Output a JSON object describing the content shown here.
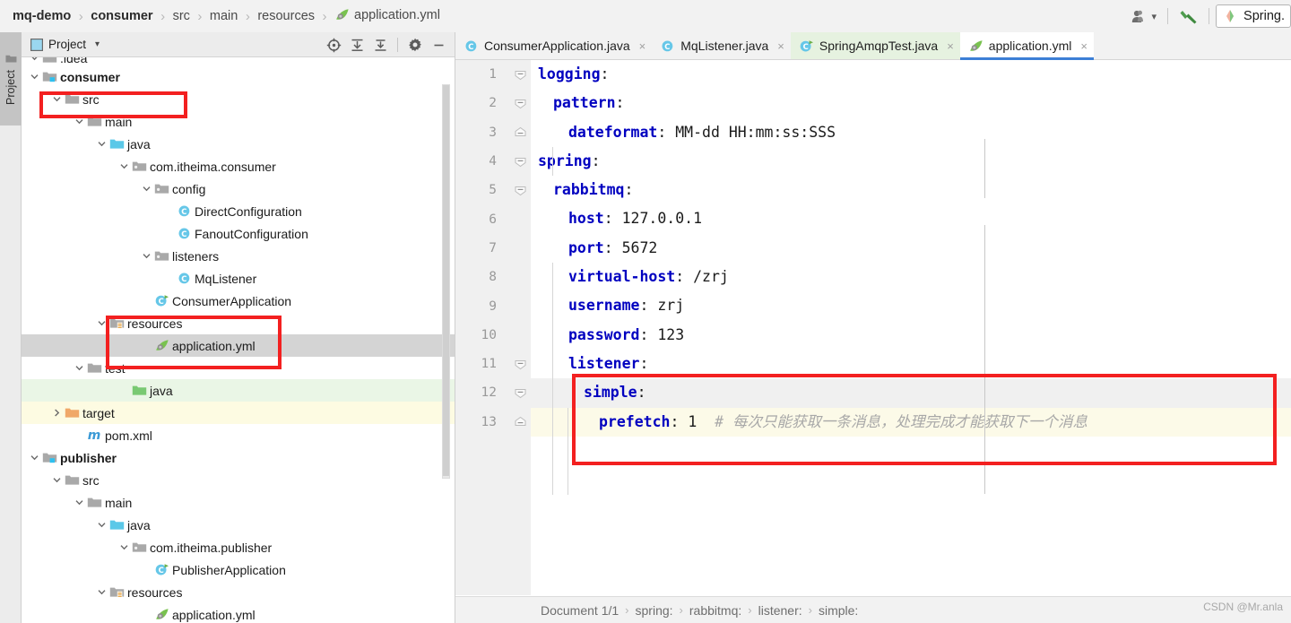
{
  "window": {
    "breadcrumb": [
      {
        "label": "mq-demo",
        "bold": true,
        "icon": ""
      },
      {
        "label": "consumer",
        "bold": true,
        "icon": ""
      },
      {
        "label": "src",
        "bold": false,
        "icon": ""
      },
      {
        "label": "main",
        "bold": false,
        "icon": ""
      },
      {
        "label": "resources",
        "bold": false,
        "icon": ""
      },
      {
        "label": "application.yml",
        "bold": false,
        "icon": "yml-leaf-icon"
      }
    ],
    "separator": "›",
    "toolbar_right": {
      "user_icon": "user-icon",
      "user_dropdown_caret": "▾",
      "hammer_icon": "build-hammer-icon",
      "run_config_label": "Spring.",
      "run_config_icon": "spring-boot-icon"
    }
  },
  "left_strip": {
    "project_tab_label": "Project",
    "project_tab_icon": "folder-icon"
  },
  "project_panel": {
    "title": "Project",
    "title_icon": "project-panel-icon",
    "title_caret": "▾",
    "tools": [
      {
        "name": "locate-in-tree-icon",
        "glyph": "⊕"
      },
      {
        "name": "expand-all-icon",
        "glyph": "↧"
      },
      {
        "name": "collapse-all-icon",
        "glyph": "↥"
      },
      {
        "name": "settings-gear-icon",
        "glyph": "⚙"
      },
      {
        "name": "hide-panel-icon",
        "glyph": "—"
      }
    ],
    "tree": [
      {
        "label": ".idea",
        "depth": 1,
        "arrow": "down",
        "icon": "folder-grey-icon",
        "bold": false,
        "state": "clipped"
      },
      {
        "label": "consumer",
        "depth": 1,
        "arrow": "down",
        "icon": "module-icon",
        "bold": true,
        "state": "boxed"
      },
      {
        "label": "src",
        "depth": 2,
        "arrow": "down",
        "icon": "folder-grey-icon",
        "bold": false,
        "state": "none"
      },
      {
        "label": "main",
        "depth": 3,
        "arrow": "down",
        "icon": "folder-grey-icon",
        "bold": false,
        "state": "none"
      },
      {
        "label": "java",
        "depth": 4,
        "arrow": "down",
        "icon": "folder-source-icon",
        "bold": false,
        "state": "none"
      },
      {
        "label": "com.itheima.consumer",
        "depth": 5,
        "arrow": "down",
        "icon": "package-icon",
        "bold": false,
        "state": "none"
      },
      {
        "label": "config",
        "depth": 6,
        "arrow": "down",
        "icon": "package-icon",
        "bold": false,
        "state": "none"
      },
      {
        "label": "DirectConfiguration",
        "depth": 7,
        "arrow": "none",
        "icon": "java-class-icon",
        "bold": false,
        "state": "none"
      },
      {
        "label": "FanoutConfiguration",
        "depth": 7,
        "arrow": "none",
        "icon": "java-class-icon",
        "bold": false,
        "state": "none"
      },
      {
        "label": "listeners",
        "depth": 6,
        "arrow": "down",
        "icon": "package-icon",
        "bold": false,
        "state": "none"
      },
      {
        "label": "MqListener",
        "depth": 7,
        "arrow": "none",
        "icon": "java-class-icon",
        "bold": false,
        "state": "none"
      },
      {
        "label": "ConsumerApplication",
        "depth": 6,
        "arrow": "none",
        "icon": "java-runnable-icon",
        "bold": false,
        "state": "none"
      },
      {
        "label": "resources",
        "depth": 4,
        "arrow": "down",
        "icon": "folder-resources-icon",
        "bold": false,
        "state": "boxed"
      },
      {
        "label": "application.yml",
        "depth": 6,
        "arrow": "none",
        "icon": "yml-leaf-icon",
        "bold": false,
        "state": "selected"
      },
      {
        "label": "test",
        "depth": 3,
        "arrow": "down",
        "icon": "folder-grey-icon",
        "bold": false,
        "state": "none"
      },
      {
        "label": "java",
        "depth": 5,
        "arrow": "none",
        "icon": "folder-test-icon",
        "bold": false,
        "state": "green"
      },
      {
        "label": "target",
        "depth": 2,
        "arrow": "right",
        "icon": "folder-excluded-icon",
        "bold": false,
        "state": "yellow"
      },
      {
        "label": "pom.xml",
        "depth": 3,
        "arrow": "none",
        "icon": "maven-icon",
        "bold": false,
        "state": "none"
      },
      {
        "label": "publisher",
        "depth": 1,
        "arrow": "down",
        "icon": "module-icon",
        "bold": true,
        "state": "none"
      },
      {
        "label": "src",
        "depth": 2,
        "arrow": "down",
        "icon": "folder-grey-icon",
        "bold": false,
        "state": "none"
      },
      {
        "label": "main",
        "depth": 3,
        "arrow": "down",
        "icon": "folder-grey-icon",
        "bold": false,
        "state": "none"
      },
      {
        "label": "java",
        "depth": 4,
        "arrow": "down",
        "icon": "folder-source-icon",
        "bold": false,
        "state": "none"
      },
      {
        "label": "com.itheima.publisher",
        "depth": 5,
        "arrow": "down",
        "icon": "package-icon",
        "bold": false,
        "state": "none"
      },
      {
        "label": "PublisherApplication",
        "depth": 6,
        "arrow": "none",
        "icon": "java-runnable-icon",
        "bold": false,
        "state": "none"
      },
      {
        "label": "resources",
        "depth": 4,
        "arrow": "down",
        "icon": "folder-resources-icon",
        "bold": false,
        "state": "none"
      },
      {
        "label": "application.yml",
        "depth": 6,
        "arrow": "none",
        "icon": "yml-leaf-icon",
        "bold": false,
        "state": "none"
      }
    ]
  },
  "editor": {
    "tabs": [
      {
        "label": "ConsumerApplication.java",
        "icon": "java-class-icon",
        "active": false,
        "highlight": "none",
        "close": "×"
      },
      {
        "label": "MqListener.java",
        "icon": "java-class-icon",
        "active": false,
        "highlight": "none",
        "close": "×"
      },
      {
        "label": "SpringAmqpTest.java",
        "icon": "java-runnable-icon",
        "active": false,
        "highlight": "green",
        "close": "×"
      },
      {
        "label": "application.yml",
        "icon": "yml-leaf-icon",
        "active": true,
        "highlight": "none",
        "close": "×"
      }
    ],
    "lines": [
      {
        "n": "1",
        "indent": 0,
        "key": "logging",
        "sep": ":",
        "value": "",
        "comment": "",
        "fold": "open-top",
        "row": "plain"
      },
      {
        "n": "2",
        "indent": 1,
        "key": "pattern",
        "sep": ":",
        "value": "",
        "comment": "",
        "fold": "open-mid",
        "row": "plain"
      },
      {
        "n": "3",
        "indent": 2,
        "key": "dateformat",
        "sep": ":",
        "value": "MM-dd HH:mm:ss:SSS",
        "comment": "",
        "fold": "end",
        "row": "plain"
      },
      {
        "n": "4",
        "indent": 0,
        "key": "spring",
        "sep": ":",
        "value": "",
        "comment": "",
        "fold": "open-top",
        "row": "plain"
      },
      {
        "n": "5",
        "indent": 1,
        "key": "rabbitmq",
        "sep": ":",
        "value": "",
        "comment": "",
        "fold": "open-mid",
        "row": "plain"
      },
      {
        "n": "6",
        "indent": 2,
        "key": "host",
        "sep": ":",
        "value": "127.0.0.1",
        "comment": "",
        "fold": "none",
        "row": "plain"
      },
      {
        "n": "7",
        "indent": 2,
        "key": "port",
        "sep": ":",
        "value": "5672",
        "comment": "",
        "fold": "none",
        "row": "plain"
      },
      {
        "n": "8",
        "indent": 2,
        "key": "virtual-host",
        "sep": ":",
        "value": "/zrj",
        "comment": "",
        "fold": "none",
        "row": "plain"
      },
      {
        "n": "9",
        "indent": 2,
        "key": "username",
        "sep": ":",
        "value": "zrj",
        "comment": "",
        "fold": "none",
        "row": "plain"
      },
      {
        "n": "10",
        "indent": 2,
        "key": "password",
        "sep": ":",
        "value": "123",
        "comment": "",
        "fold": "none",
        "row": "plain"
      },
      {
        "n": "11",
        "indent": 2,
        "key": "listener",
        "sep": ":",
        "value": "",
        "comment": "",
        "fold": "open-mid",
        "row": "plain"
      },
      {
        "n": "12",
        "indent": 3,
        "key": "simple",
        "sep": ":",
        "value": "",
        "comment": "",
        "fold": "open-mid",
        "row": "hl"
      },
      {
        "n": "13",
        "indent": 4,
        "key": "prefetch",
        "sep": ":",
        "value": "1",
        "comment": "# 每次只能获取一条消息，处理完成才能获取下一个消息",
        "fold": "end",
        "row": "caret"
      }
    ],
    "status_bar": {
      "document_label": "Document 1/1",
      "separator": "›",
      "path": [
        "spring:",
        "rabbitmq:",
        "listener:",
        "simple:"
      ],
      "watermark": "CSDN @Mr.anla"
    }
  },
  "colors": {
    "accent_blue": "#3c7fd6",
    "key_blue": "#0000c0",
    "comment_grey": "#a8a8a8",
    "annotation_red": "#f32020",
    "selection_grey": "#d4d4d4",
    "caret_line_yellow": "#fcfae8",
    "test_green": "#eaf6e6",
    "excluded_yellow": "#fdfbe2"
  }
}
